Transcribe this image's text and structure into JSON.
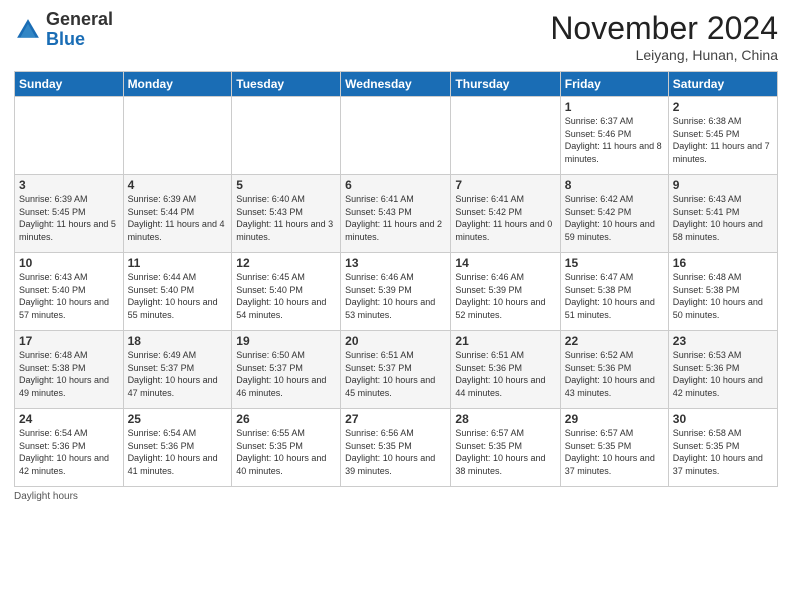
{
  "header": {
    "logo_general": "General",
    "logo_blue": "Blue",
    "month_title": "November 2024",
    "location": "Leiyang, Hunan, China"
  },
  "days_of_week": [
    "Sunday",
    "Monday",
    "Tuesday",
    "Wednesday",
    "Thursday",
    "Friday",
    "Saturday"
  ],
  "weeks": [
    [
      {
        "day": "",
        "info": ""
      },
      {
        "day": "",
        "info": ""
      },
      {
        "day": "",
        "info": ""
      },
      {
        "day": "",
        "info": ""
      },
      {
        "day": "",
        "info": ""
      },
      {
        "day": "1",
        "info": "Sunrise: 6:37 AM\nSunset: 5:46 PM\nDaylight: 11 hours and 8 minutes."
      },
      {
        "day": "2",
        "info": "Sunrise: 6:38 AM\nSunset: 5:45 PM\nDaylight: 11 hours and 7 minutes."
      }
    ],
    [
      {
        "day": "3",
        "info": "Sunrise: 6:39 AM\nSunset: 5:45 PM\nDaylight: 11 hours and 5 minutes."
      },
      {
        "day": "4",
        "info": "Sunrise: 6:39 AM\nSunset: 5:44 PM\nDaylight: 11 hours and 4 minutes."
      },
      {
        "day": "5",
        "info": "Sunrise: 6:40 AM\nSunset: 5:43 PM\nDaylight: 11 hours and 3 minutes."
      },
      {
        "day": "6",
        "info": "Sunrise: 6:41 AM\nSunset: 5:43 PM\nDaylight: 11 hours and 2 minutes."
      },
      {
        "day": "7",
        "info": "Sunrise: 6:41 AM\nSunset: 5:42 PM\nDaylight: 11 hours and 0 minutes."
      },
      {
        "day": "8",
        "info": "Sunrise: 6:42 AM\nSunset: 5:42 PM\nDaylight: 10 hours and 59 minutes."
      },
      {
        "day": "9",
        "info": "Sunrise: 6:43 AM\nSunset: 5:41 PM\nDaylight: 10 hours and 58 minutes."
      }
    ],
    [
      {
        "day": "10",
        "info": "Sunrise: 6:43 AM\nSunset: 5:40 PM\nDaylight: 10 hours and 57 minutes."
      },
      {
        "day": "11",
        "info": "Sunrise: 6:44 AM\nSunset: 5:40 PM\nDaylight: 10 hours and 55 minutes."
      },
      {
        "day": "12",
        "info": "Sunrise: 6:45 AM\nSunset: 5:40 PM\nDaylight: 10 hours and 54 minutes."
      },
      {
        "day": "13",
        "info": "Sunrise: 6:46 AM\nSunset: 5:39 PM\nDaylight: 10 hours and 53 minutes."
      },
      {
        "day": "14",
        "info": "Sunrise: 6:46 AM\nSunset: 5:39 PM\nDaylight: 10 hours and 52 minutes."
      },
      {
        "day": "15",
        "info": "Sunrise: 6:47 AM\nSunset: 5:38 PM\nDaylight: 10 hours and 51 minutes."
      },
      {
        "day": "16",
        "info": "Sunrise: 6:48 AM\nSunset: 5:38 PM\nDaylight: 10 hours and 50 minutes."
      }
    ],
    [
      {
        "day": "17",
        "info": "Sunrise: 6:48 AM\nSunset: 5:38 PM\nDaylight: 10 hours and 49 minutes."
      },
      {
        "day": "18",
        "info": "Sunrise: 6:49 AM\nSunset: 5:37 PM\nDaylight: 10 hours and 47 minutes."
      },
      {
        "day": "19",
        "info": "Sunrise: 6:50 AM\nSunset: 5:37 PM\nDaylight: 10 hours and 46 minutes."
      },
      {
        "day": "20",
        "info": "Sunrise: 6:51 AM\nSunset: 5:37 PM\nDaylight: 10 hours and 45 minutes."
      },
      {
        "day": "21",
        "info": "Sunrise: 6:51 AM\nSunset: 5:36 PM\nDaylight: 10 hours and 44 minutes."
      },
      {
        "day": "22",
        "info": "Sunrise: 6:52 AM\nSunset: 5:36 PM\nDaylight: 10 hours and 43 minutes."
      },
      {
        "day": "23",
        "info": "Sunrise: 6:53 AM\nSunset: 5:36 PM\nDaylight: 10 hours and 42 minutes."
      }
    ],
    [
      {
        "day": "24",
        "info": "Sunrise: 6:54 AM\nSunset: 5:36 PM\nDaylight: 10 hours and 42 minutes."
      },
      {
        "day": "25",
        "info": "Sunrise: 6:54 AM\nSunset: 5:36 PM\nDaylight: 10 hours and 41 minutes."
      },
      {
        "day": "26",
        "info": "Sunrise: 6:55 AM\nSunset: 5:35 PM\nDaylight: 10 hours and 40 minutes."
      },
      {
        "day": "27",
        "info": "Sunrise: 6:56 AM\nSunset: 5:35 PM\nDaylight: 10 hours and 39 minutes."
      },
      {
        "day": "28",
        "info": "Sunrise: 6:57 AM\nSunset: 5:35 PM\nDaylight: 10 hours and 38 minutes."
      },
      {
        "day": "29",
        "info": "Sunrise: 6:57 AM\nSunset: 5:35 PM\nDaylight: 10 hours and 37 minutes."
      },
      {
        "day": "30",
        "info": "Sunrise: 6:58 AM\nSunset: 5:35 PM\nDaylight: 10 hours and 37 minutes."
      }
    ]
  ],
  "footer": {
    "note": "Daylight hours"
  }
}
